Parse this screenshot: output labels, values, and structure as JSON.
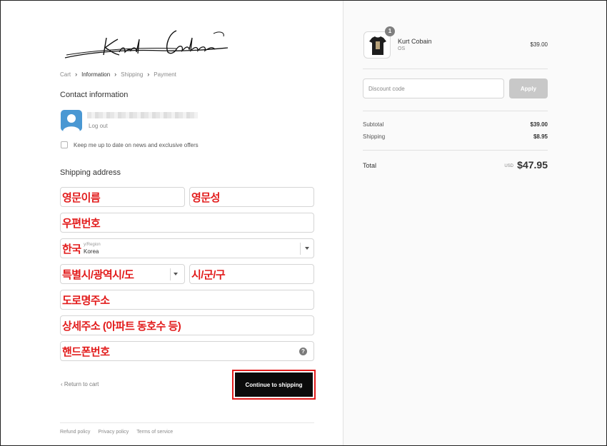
{
  "brand": {
    "logo_text": "Kurt Cobain"
  },
  "breadcrumb": {
    "items": [
      "Cart",
      "Information",
      "Shipping",
      "Payment"
    ],
    "separator": ">"
  },
  "contact": {
    "title": "Contact information",
    "logout": "Log out",
    "newsletter_label": "Keep me up to date on news and exclusive offers"
  },
  "shipping": {
    "title": "Shipping address",
    "first_name_annotation": "영문이름",
    "last_name_annotation": "영문성",
    "postal_annotation": "우편번호",
    "country_annotation": "한국",
    "country_label": "y/Region",
    "country_value": "Korea",
    "province_annotation": "특별시/광역시/도",
    "city_annotation": "시/군/구",
    "address_annotation": "도로명주소",
    "apartment_annotation": "상세주소 (아파트 동호수 등)",
    "phone_annotation": "핸드폰번호",
    "help_glyph": "?"
  },
  "actions": {
    "return_label": "Return to cart",
    "continue_label": "Continue to shipping"
  },
  "footer": {
    "links": [
      "Refund policy",
      "Privacy policy",
      "Terms of service"
    ]
  },
  "order": {
    "quantity": "1",
    "product_name": "Kurt Cobain",
    "product_variant": "OS",
    "product_price": "$39.00",
    "discount_placeholder": "Discount code",
    "apply_label": "Apply",
    "subtotal_label": "Subtotal",
    "subtotal_value": "$39.00",
    "shipping_label": "Shipping",
    "shipping_value": "$8.95",
    "total_label": "Total",
    "currency": "USD",
    "total_value": "$47.95"
  },
  "colors": {
    "annotation": "#e21b1b",
    "button_bg": "#0b0b0b",
    "apply_bg": "#c8c8c8",
    "avatar": "#4a98d3",
    "sidebar_bg": "#fafafa"
  },
  "icons": [
    "avatar-icon",
    "chevron-down-icon",
    "help-icon",
    "chevron-left-icon",
    "chevron-right-icon"
  ]
}
